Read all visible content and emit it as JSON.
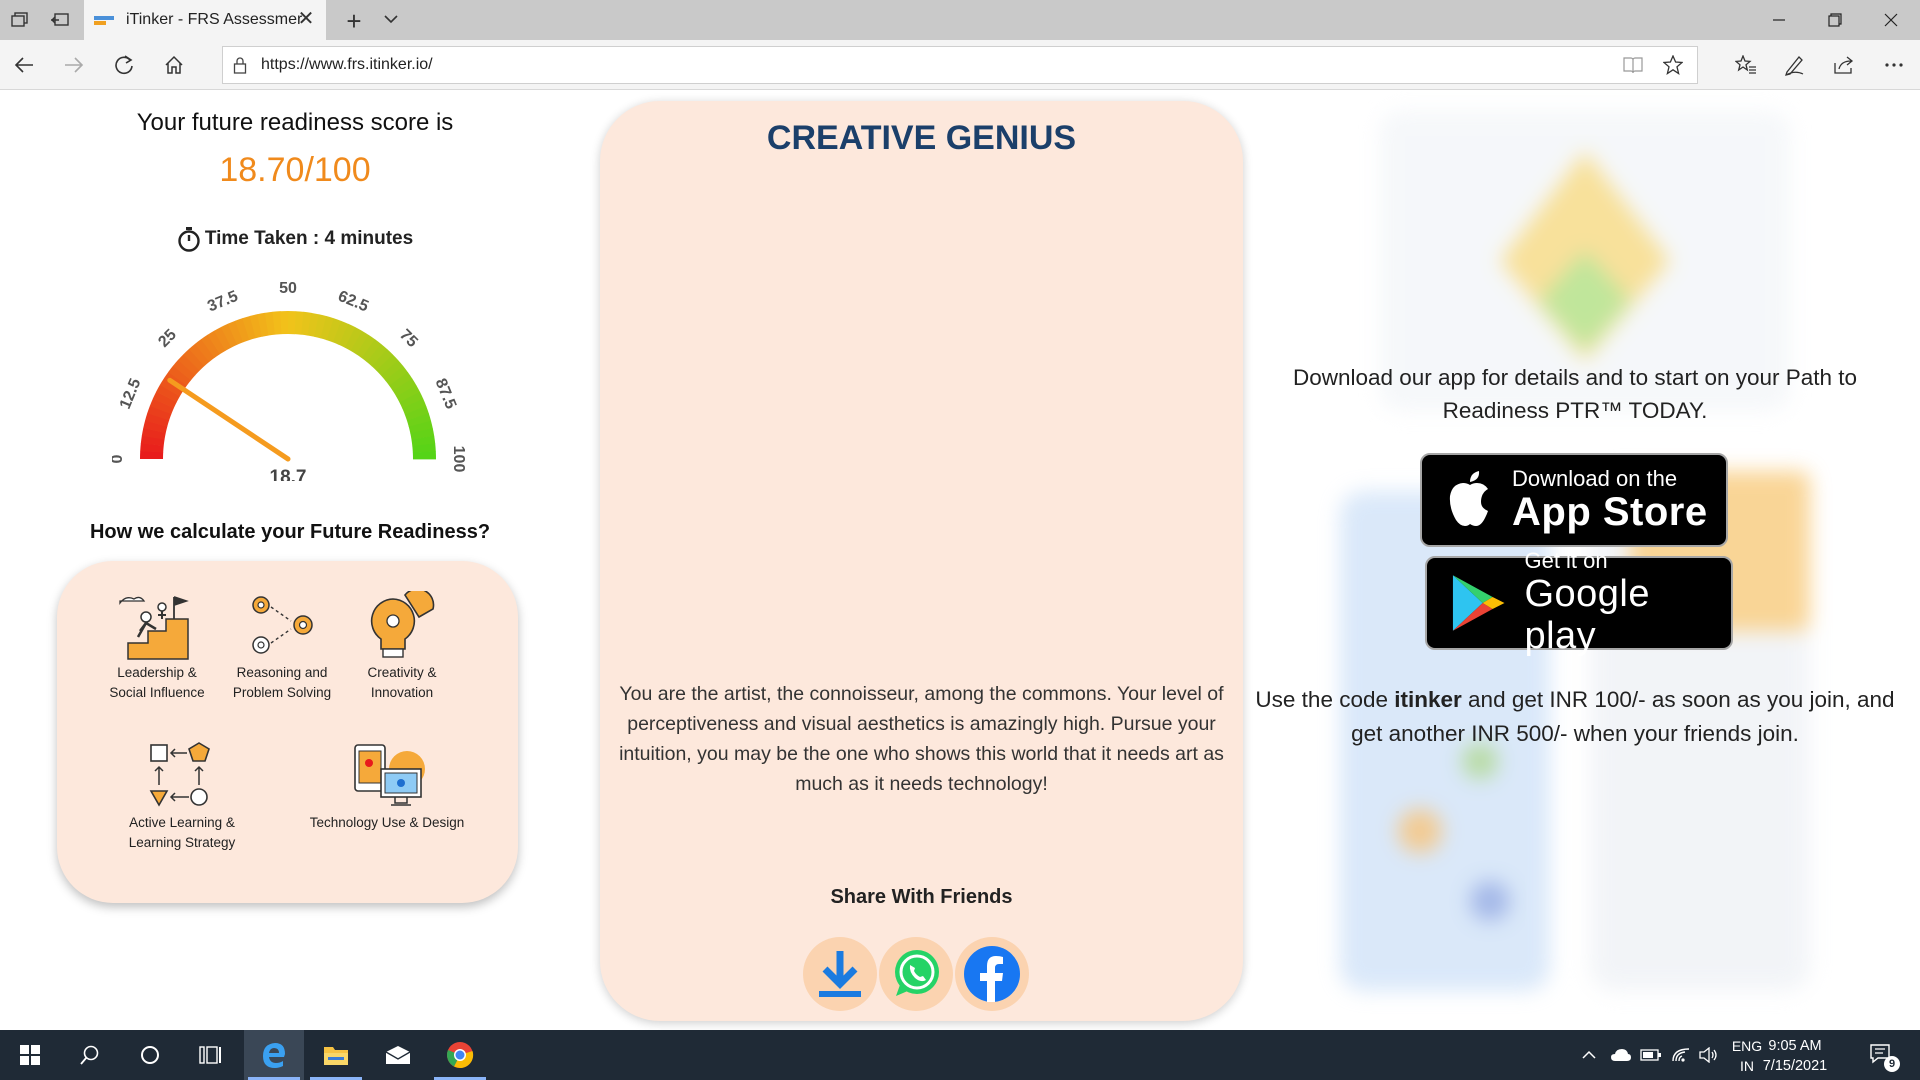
{
  "browser": {
    "tab_title": "iTinker - FRS Assessmer",
    "url": "https://www.frs.itinker.io/"
  },
  "score": {
    "title": "Your future readiness score is",
    "value": "18.70/100",
    "time_taken": "Time Taken : 4 minutes"
  },
  "gauge": {
    "min": 0,
    "max": 100,
    "value": 18.7,
    "value_label": "18.7",
    "tick_labels": [
      "0",
      "12.5",
      "25",
      "37.5",
      "50",
      "62.5",
      "75",
      "87.5",
      "100"
    ],
    "colors": {
      "low": "#e8191c",
      "mid": "#f2c31a",
      "high": "#52d417",
      "needle": "#f59b1e"
    }
  },
  "calculation": {
    "title": "How we calculate your Future Readiness?",
    "factors": [
      {
        "label": "Leadership & Social Influence",
        "icon": "leadership-icon"
      },
      {
        "label": "Reasoning and Problem Solving",
        "icon": "gears-icon"
      },
      {
        "label": "Creativity & Innovation",
        "icon": "creativity-bulb-icon"
      },
      {
        "label": "Active Learning & Learning Strategy",
        "icon": "learning-flow-icon"
      },
      {
        "label": "Technology Use & Design",
        "icon": "technology-devices-icon"
      }
    ]
  },
  "persona": {
    "title": "CREATIVE GENIUS",
    "description": "You are the artist, the connoisseur, among the commons. Your level of perceptiveness and visual aesthetics is amazingly high. Pursue your intuition, you may be the one who shows this world that it needs art as much as it needs technology!",
    "share_title": "Share With Friends",
    "share_buttons": [
      "download-icon",
      "whatsapp-icon",
      "facebook-icon"
    ]
  },
  "app_promo": {
    "download_text": "Download our app for details and to start on your Path to Readiness PTR™ TODAY.",
    "app_store_small": "Download on the",
    "app_store_big": "App Store",
    "google_small": "Get it on",
    "google_big": "Google play",
    "code_prefix": "Use the code ",
    "code": "itinker",
    "code_suffix": " and get INR 100/- as soon as you join, and get another INR 500/- when your friends join."
  },
  "taskbar": {
    "lang_line1": "ENG",
    "lang_line2": "IN",
    "time": "9:05 AM",
    "date": "7/15/2021",
    "notifications": "9"
  }
}
